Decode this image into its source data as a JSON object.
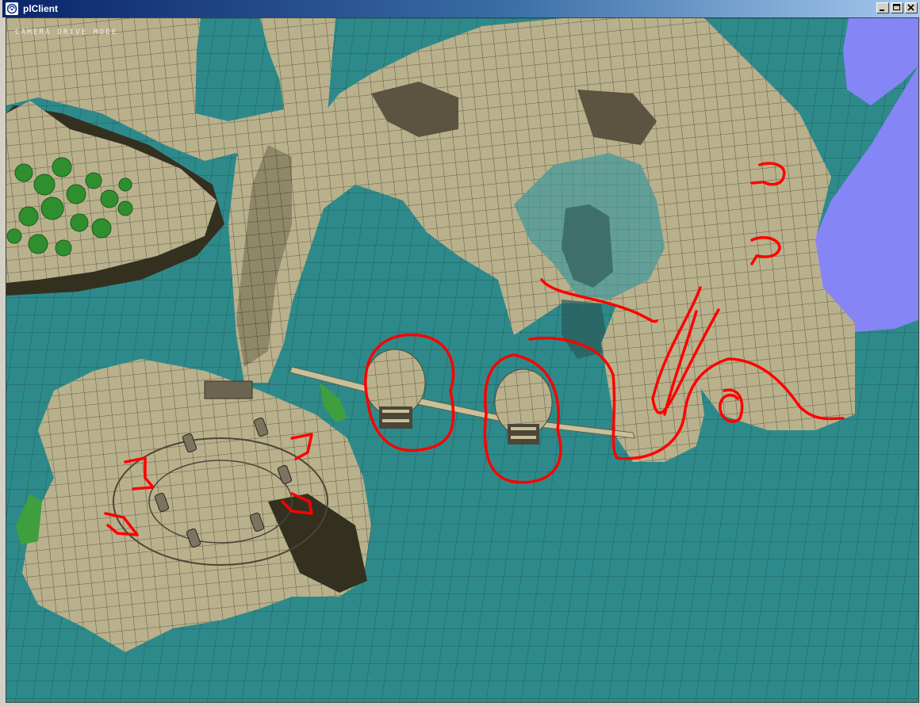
{
  "window": {
    "title": "plClient",
    "icon": "plasma-client-icon",
    "controls": [
      "minimize-icon",
      "maximize-icon",
      "close-icon"
    ]
  },
  "hud": {
    "mode_label": "CAMERA DRIVE MODE"
  },
  "colors": {
    "title_bar_start": "#0a246a",
    "title_bar_end": "#a6caf0",
    "water": "#2e8a8a",
    "terrain": "#b9b08c",
    "sky": "#8585f5",
    "annotation": "#ff0000"
  }
}
